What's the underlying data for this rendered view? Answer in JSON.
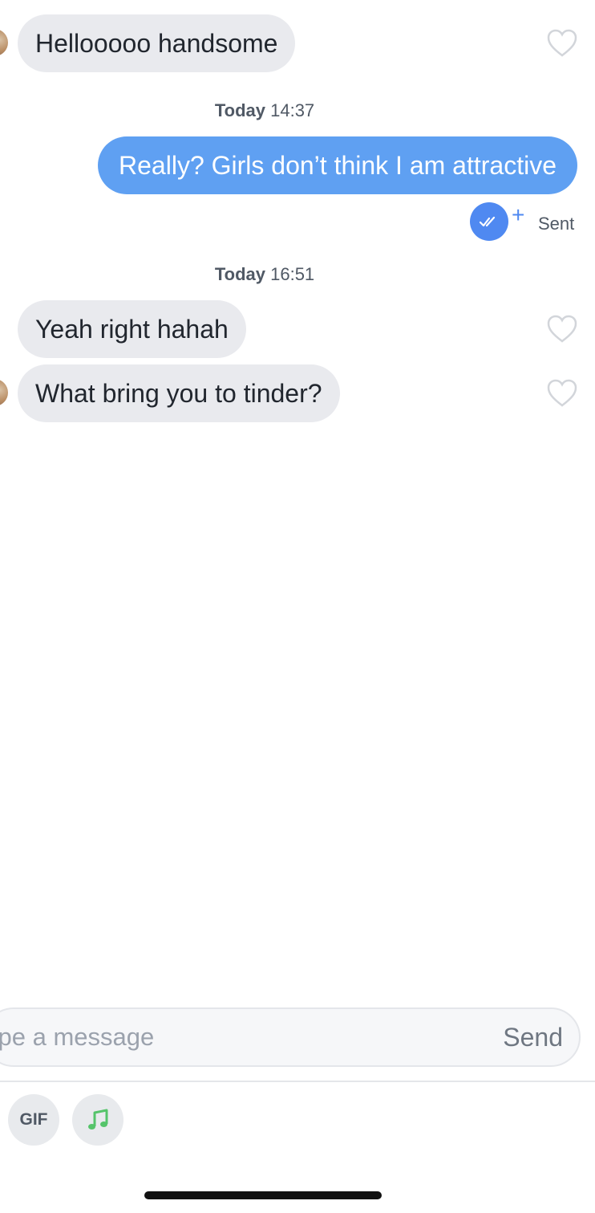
{
  "messages": [
    {
      "direction": "incoming",
      "text": "Hellooooo handsome"
    },
    {
      "timestamp_day": "Today",
      "timestamp_time": "14:37"
    },
    {
      "direction": "outgoing",
      "text": "Really? Girls don’t think I am attractive",
      "status": "Sent"
    },
    {
      "timestamp_day": "Today",
      "timestamp_time": "16:51"
    },
    {
      "direction": "incoming",
      "text": "Yeah right hahah"
    },
    {
      "direction": "incoming",
      "text": "What bring you to tinder?"
    }
  ],
  "composer": {
    "placeholder": "ype a message",
    "send_label": "Send"
  },
  "toolbar": {
    "gif_label": "GIF",
    "music_icon": "music-note-icon"
  },
  "colors": {
    "outgoing_bubble": "#5fa0f2",
    "incoming_bubble": "#e9eaee",
    "read_receipt": "#4f89f1",
    "music_icon": "#55c46a"
  }
}
